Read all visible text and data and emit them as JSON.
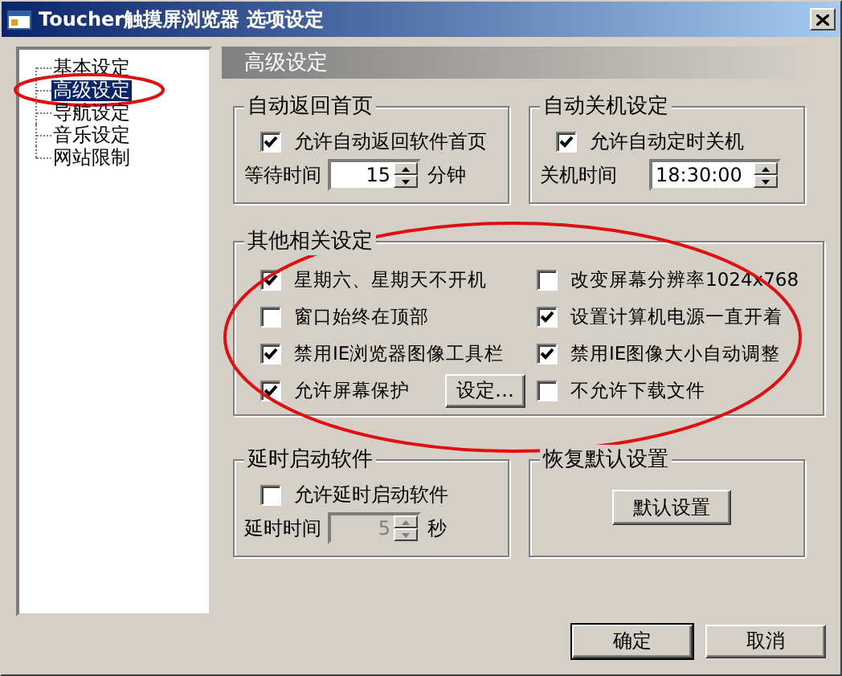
{
  "window": {
    "title": "Toucher触摸屏浏览器 选项设定"
  },
  "tree": {
    "items": [
      {
        "label": "基本设定",
        "selected": false,
        "highlighted": false
      },
      {
        "label": "高级设定",
        "selected": true,
        "highlighted": true
      },
      {
        "label": "导航设定",
        "selected": false,
        "highlighted": false
      },
      {
        "label": "音乐设定",
        "selected": false,
        "highlighted": false
      },
      {
        "label": "网站限制",
        "selected": false,
        "highlighted": false
      }
    ]
  },
  "panel": {
    "title": "高级设定"
  },
  "auto_return": {
    "title": "自动返回首页",
    "checkbox": {
      "label": "允许自动返回软件首页",
      "checked": true
    },
    "spin": {
      "label": "等待时间",
      "value": "15",
      "unit": "分钟",
      "kind": "number",
      "disabled": false
    }
  },
  "auto_shutdown": {
    "title": "自动关机设定",
    "checkbox": {
      "label": "允许自动定时关机",
      "checked": true
    },
    "spin": {
      "label": "关机时间",
      "value": "18:30:00",
      "kind": "time",
      "disabled": false
    }
  },
  "other": {
    "title": "其他相关设定",
    "highlighted": true,
    "options": [
      {
        "label": "星期六、星期天不开机",
        "checked": true
      },
      {
        "label": "改变屏幕分辨率1024x768",
        "checked": false
      },
      {
        "label": "窗口始终在顶部",
        "checked": false
      },
      {
        "label": "设置计算机电源一直开着",
        "checked": true
      },
      {
        "label": "禁用IE浏览器图像工具栏",
        "checked": true
      },
      {
        "label": "禁用IE图像大小自动调整",
        "checked": true
      },
      {
        "label": "允许屏幕保护",
        "checked": true,
        "button": "设定…"
      },
      {
        "label": "不允许下载文件",
        "checked": false
      }
    ]
  },
  "delay": {
    "title": "延时启动软件",
    "checkbox": {
      "label": "允许延时启动软件",
      "checked": false
    },
    "spin": {
      "label": "延时时间",
      "value": "5",
      "unit": "秒",
      "kind": "number",
      "disabled": true
    }
  },
  "restore": {
    "title": "恢复默认设置",
    "button": "默认设置"
  },
  "buttons": [
    "确定",
    "取消"
  ]
}
